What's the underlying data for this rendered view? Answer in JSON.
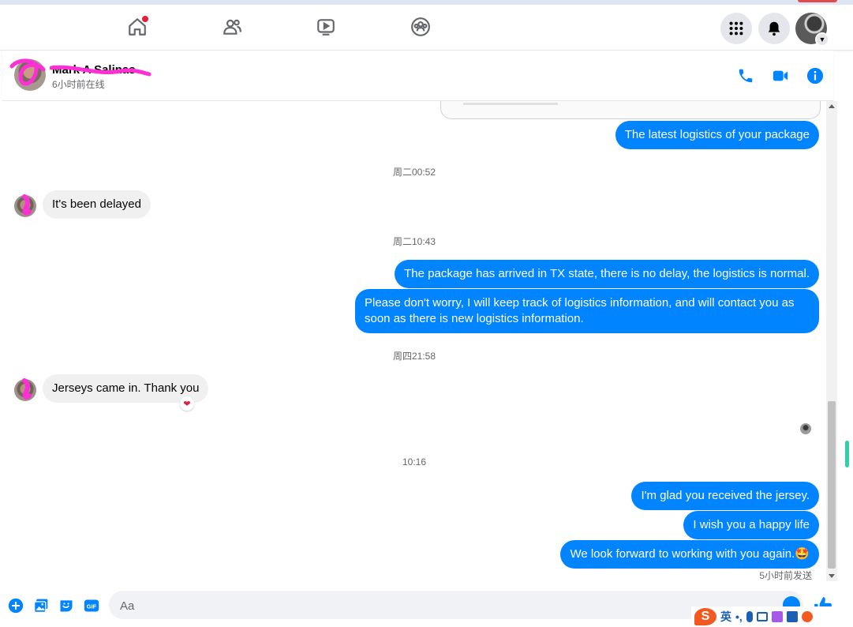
{
  "colors": {
    "messenger_blue": "#0084ff",
    "incoming_bubble": "#f0f0f0",
    "highlight_scribble": "#ff2fd6",
    "notification_red": "#e41e3f"
  },
  "topnav": {
    "icons": [
      "home-icon",
      "friends-icon",
      "watch-icon",
      "groups-icon"
    ],
    "right_icons": [
      "menu-grid-icon",
      "bell-icon",
      "account-avatar"
    ]
  },
  "header": {
    "contact_name": "Mark A Salinas",
    "status": "6小时前在线",
    "actions": [
      "phone-icon",
      "video-icon",
      "info-icon"
    ]
  },
  "thread": {
    "messages": [
      {
        "dir": "out",
        "text": "The latest logistics of your package"
      },
      {
        "type": "time",
        "text": "周二00:52"
      },
      {
        "dir": "in",
        "text": "It's been delayed"
      },
      {
        "type": "time",
        "text": "周二10:43"
      },
      {
        "dir": "out",
        "text": "The package has arrived in TX state, there is no delay, the logistics is normal."
      },
      {
        "dir": "out",
        "text": "Please don't worry, I will keep track of logistics information, and will contact you as soon as there is new logistics information."
      },
      {
        "type": "time",
        "text": "周四21:58"
      },
      {
        "dir": "in",
        "text": "Jerseys came in. Thank you",
        "reaction": "heart-reaction"
      },
      {
        "type": "time",
        "text": "10:16"
      },
      {
        "dir": "out",
        "text": "I'm glad you received the jersey."
      },
      {
        "dir": "out",
        "text": "I wish you a happy life"
      },
      {
        "dir": "out",
        "text": "We look forward to working with you again.🤩"
      }
    ],
    "sent_status": "5小时前发送"
  },
  "composer": {
    "placeholder": "Aa",
    "value": "",
    "buttons": [
      "plus-icon",
      "photo-icon",
      "sticker-icon",
      "gif-icon"
    ],
    "gif_label": "GIF"
  },
  "ime": {
    "mode": "英",
    "punct": "•,"
  }
}
